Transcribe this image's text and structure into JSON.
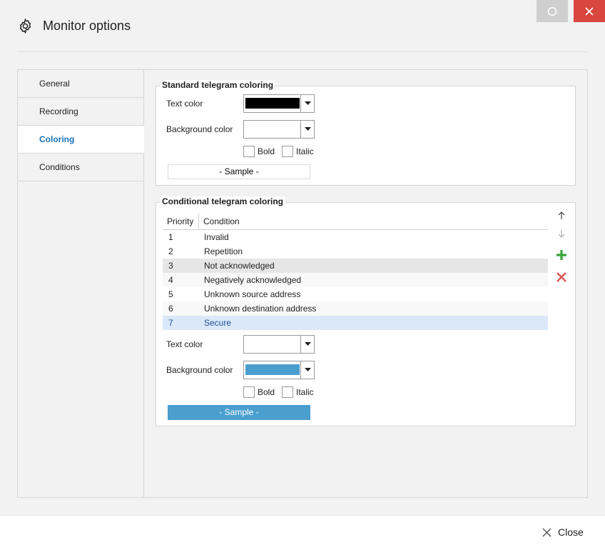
{
  "window": {
    "title": "Monitor options",
    "icon": "gear-icon"
  },
  "nav": {
    "items": [
      {
        "label": "General"
      },
      {
        "label": "Recording"
      },
      {
        "label": "Coloring"
      },
      {
        "label": "Conditions"
      }
    ],
    "active": "Coloring"
  },
  "standard": {
    "title": "Standard telegram coloring",
    "text_color_label": "Text color",
    "text_color": "#000000",
    "background_color_label": "Background color",
    "background_color": "#ffffff",
    "bold_label": "Bold",
    "bold": false,
    "italic_label": "Italic",
    "italic": false,
    "sample_label": "- Sample -"
  },
  "conditional": {
    "title": "Conditional telegram coloring",
    "columns": [
      "Priority",
      "Condition"
    ],
    "rows": [
      {
        "priority": "1",
        "condition": "Invalid"
      },
      {
        "priority": "2",
        "condition": "Repetition"
      },
      {
        "priority": "3",
        "condition": "Not acknowledged"
      },
      {
        "priority": "4",
        "condition": "Negatively acknowledged"
      },
      {
        "priority": "5",
        "condition": "Unknown source address"
      },
      {
        "priority": "6",
        "condition": "Unknown destination address"
      },
      {
        "priority": "7",
        "condition": "Secure"
      }
    ],
    "selected_row": "7",
    "text_color_label": "Text color",
    "text_color": "#ffffff",
    "background_color_label": "Background color",
    "background_color": "#4a9fcf",
    "bold_label": "Bold",
    "bold": false,
    "italic_label": "Italic",
    "italic": false,
    "sample_label": "- Sample -",
    "actions": [
      "arrow-up-icon",
      "arrow-down-icon",
      "add-icon",
      "delete-icon"
    ]
  },
  "footer": {
    "close_label": "Close"
  },
  "colors": {
    "accent": "#1a73b5",
    "close_red": "#d9453f",
    "add_green": "#3aa23a",
    "delete_red": "#e05a5a",
    "selection": "#dbe8f9"
  }
}
